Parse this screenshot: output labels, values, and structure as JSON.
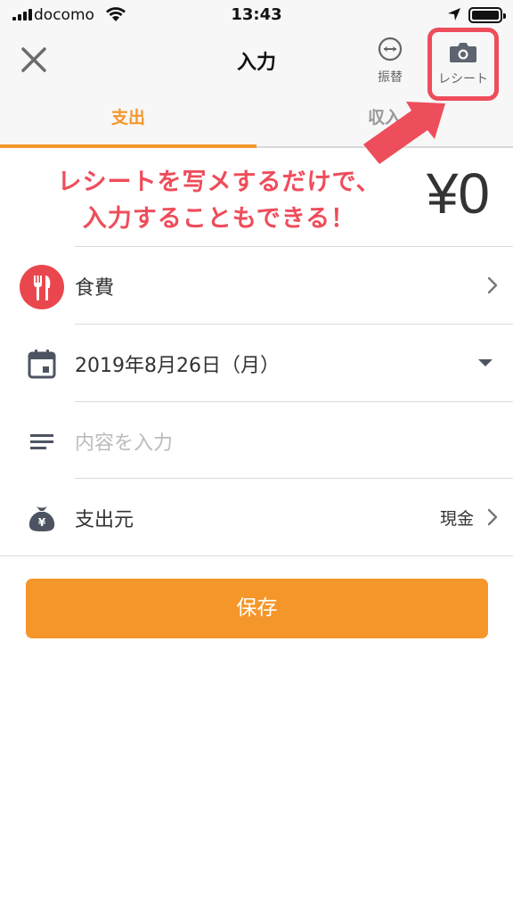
{
  "status_bar": {
    "carrier": "docomo",
    "time": "13:43"
  },
  "navbar": {
    "title": "入力",
    "transfer_label": "振替",
    "receipt_label": "レシート"
  },
  "tabs": {
    "expense": "支出",
    "income": "収入"
  },
  "annotation": {
    "line1": "レシートを写メするだけで、",
    "line2": "入力することもできる！"
  },
  "amount": "¥0",
  "form": {
    "category": "食費",
    "date": "2019年8月26日（月）",
    "memo_placeholder": "内容を入力",
    "source_label": "支出元",
    "source_value": "現金"
  },
  "save_label": "保存",
  "colors": {
    "accent": "#f5962a",
    "highlight_red": "#ee4d5b",
    "category_icon_bg": "#e9474d"
  },
  "icons": [
    "signal-icon",
    "wifi-icon",
    "location-icon",
    "battery-icon",
    "close-icon",
    "transfer-icon",
    "camera-icon",
    "fork-knife-icon",
    "calendar-icon",
    "memo-lines-icon",
    "money-bag-icon",
    "chevron-right-icon",
    "caret-down-icon"
  ]
}
